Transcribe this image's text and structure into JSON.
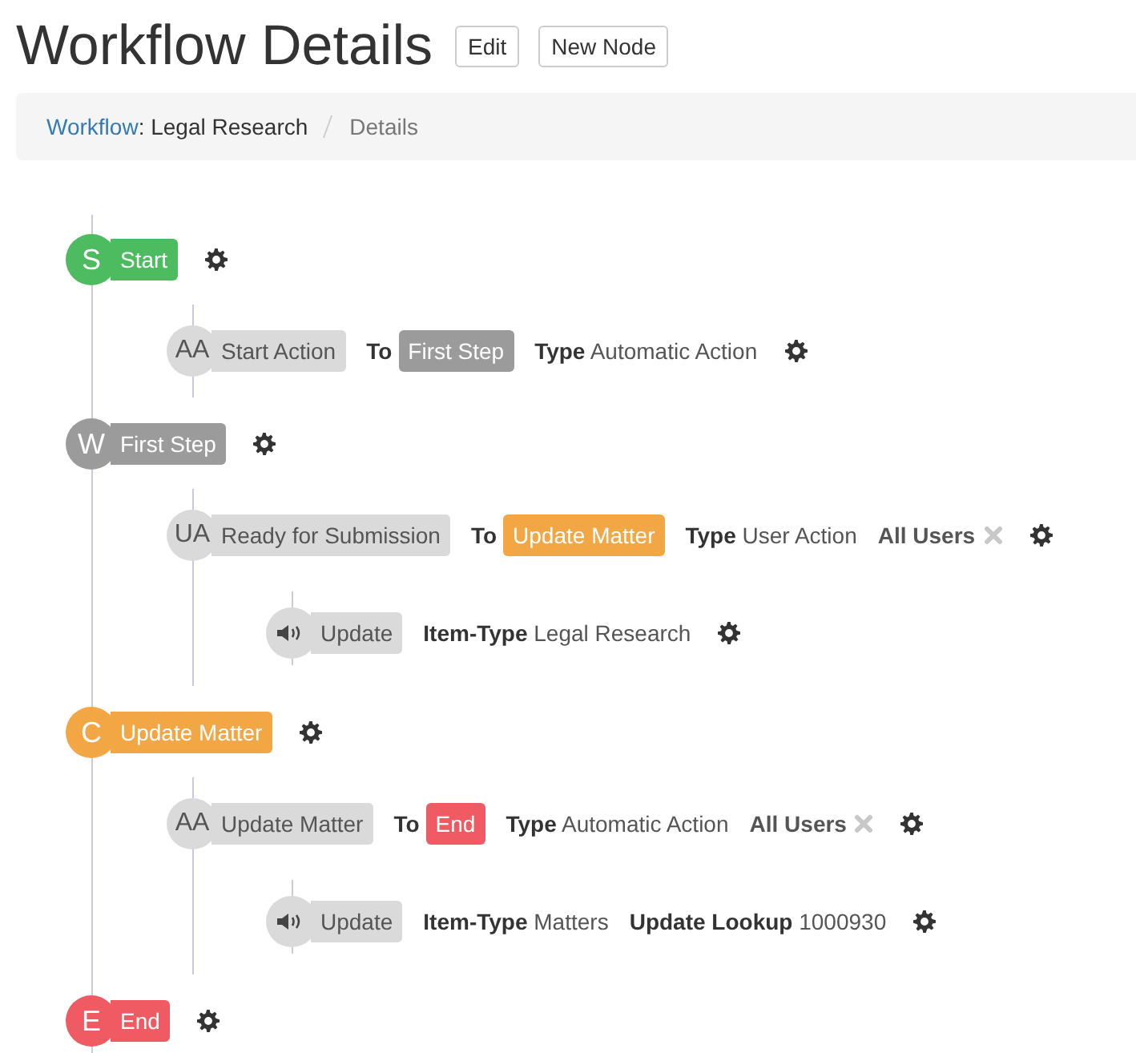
{
  "title": "Workflow Details",
  "buttons": [
    "Edit",
    "New Node"
  ],
  "breadcrumb": {
    "link": "Workflow",
    "rest": ": Legal Research",
    "current": "Details"
  },
  "nodes": [
    {
      "badge": "S",
      "label": "Start",
      "color": "#4dbb5f",
      "actions": [
        {
          "badge": "AA",
          "label": "Start Action",
          "to_label": "To",
          "to": {
            "label": "First Step",
            "color": "#9b9b9b"
          },
          "details": [
            {
              "key": "Type",
              "value": "Automatic Action"
            }
          ]
        }
      ]
    },
    {
      "badge": "W",
      "label": "First Step",
      "color": "#9b9b9b",
      "actions": [
        {
          "badge": "UA",
          "label": "Ready for Submission",
          "to_label": "To",
          "to": {
            "label": "Update Matter",
            "color": "#f2a744"
          },
          "details": [
            {
              "key": "Type",
              "value": "User Action"
            }
          ],
          "users": "All Users",
          "events": [
            {
              "kind": "sound",
              "label": "Update",
              "details": [
                {
                  "key": "Item-Type",
                  "value": "Legal Research"
                }
              ]
            }
          ]
        }
      ]
    },
    {
      "badge": "C",
      "label": "Update Matter",
      "color": "#f2a744",
      "actions": [
        {
          "badge": "AA",
          "label": "Update Matter",
          "to_label": "To",
          "to": {
            "label": "End",
            "color": "#ef5a63"
          },
          "details": [
            {
              "key": "Type",
              "value": "Automatic Action"
            }
          ],
          "users": "All Users",
          "events": [
            {
              "kind": "sound",
              "label": "Update",
              "details": [
                {
                  "key": "Item-Type",
                  "value": "Matters"
                },
                {
                  "key": "Update Lookup",
                  "value": "1000930"
                }
              ]
            }
          ]
        }
      ]
    },
    {
      "badge": "E",
      "label": "End",
      "color": "#ef5a63"
    }
  ]
}
